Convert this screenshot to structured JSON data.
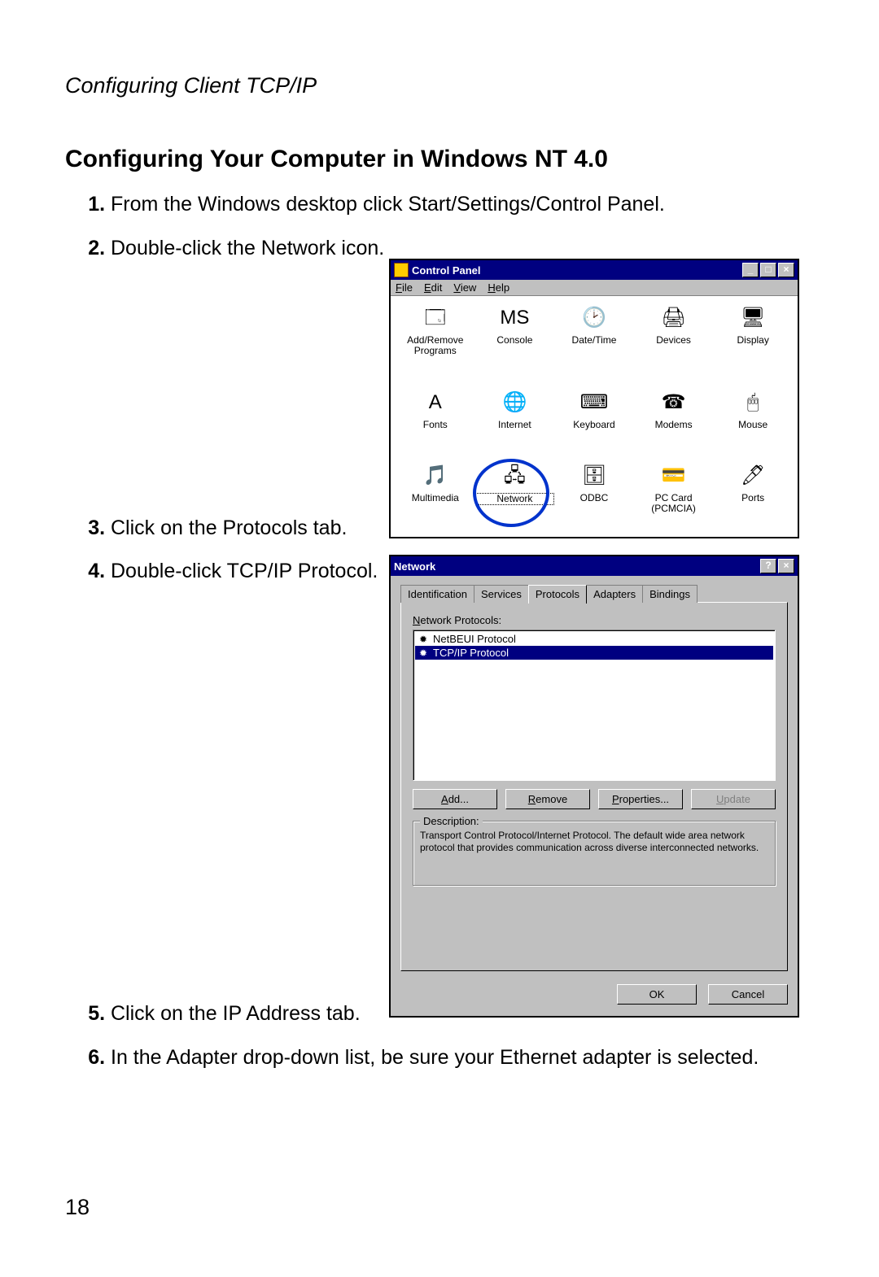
{
  "chapter": "Configuring Client TCP/IP",
  "section": "Configuring Your Computer in Windows NT 4.0",
  "steps": [
    "From the Windows desktop click Start/Settings/Control Panel.",
    "Double-click the Network icon.",
    "Click on the Protocols tab.",
    "Double-click TCP/IP Protocol.",
    "Click on the IP Address tab.",
    "In the Adapter drop-down list, be sure your Ethernet adapter is selected."
  ],
  "page_number": "18",
  "controlPanel": {
    "title": "Control Panel",
    "menus": [
      "File",
      "Edit",
      "View",
      "Help"
    ],
    "items": [
      {
        "label": "Add/Remove Programs",
        "glyph": "🗔"
      },
      {
        "label": "Console",
        "glyph": "MS"
      },
      {
        "label": "Date/Time",
        "glyph": "🕑"
      },
      {
        "label": "Devices",
        "glyph": "🖨"
      },
      {
        "label": "Display",
        "glyph": "🖥"
      },
      {
        "label": "Fonts",
        "glyph": "A"
      },
      {
        "label": "Internet",
        "glyph": "🌐"
      },
      {
        "label": "Keyboard",
        "glyph": "⌨"
      },
      {
        "label": "Modems",
        "glyph": "☎"
      },
      {
        "label": "Mouse",
        "glyph": "🖱"
      },
      {
        "label": "Multimedia",
        "glyph": "🎵"
      },
      {
        "label": "Network",
        "glyph": "🖧",
        "selected": true
      },
      {
        "label": "ODBC",
        "glyph": "🗄"
      },
      {
        "label": "PC Card (PCMCIA)",
        "glyph": "💳"
      },
      {
        "label": "Ports",
        "glyph": "🖊"
      }
    ],
    "winbtns": {
      "min": "_",
      "max": "□",
      "close": "×"
    }
  },
  "network": {
    "title": "Network",
    "help": "?",
    "close": "×",
    "tabs": [
      "Identification",
      "Services",
      "Protocols",
      "Adapters",
      "Bindings"
    ],
    "active_tab": "Protocols",
    "list_label": "Network Protocols:",
    "protocols": [
      {
        "name": "NetBEUI Protocol",
        "selected": false
      },
      {
        "name": "TCP/IP Protocol",
        "selected": true
      }
    ],
    "buttons": {
      "add": "Add...",
      "remove": "Remove",
      "properties": "Properties...",
      "update": "Update"
    },
    "desc_label": "Description:",
    "desc": "Transport Control Protocol/Internet Protocol. The default wide area network protocol that provides communication across diverse interconnected networks.",
    "ok": "OK",
    "cancel": "Cancel"
  }
}
